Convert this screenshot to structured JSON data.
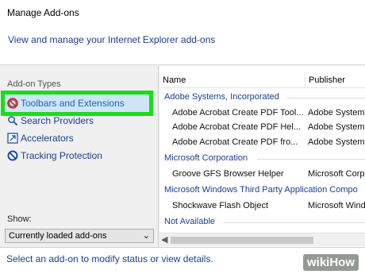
{
  "window": {
    "title": "Manage Add-ons"
  },
  "header": {
    "description": "View and manage your Internet Explorer add-ons"
  },
  "addon_types": {
    "label": "Add-on Types",
    "items": [
      {
        "label": "Toolbars and Extensions",
        "icon": "gear-no-icon",
        "selected": true
      },
      {
        "label": "Search Providers",
        "icon": "search-icon",
        "selected": false
      },
      {
        "label": "Accelerators",
        "icon": "accelerator-icon",
        "selected": false
      },
      {
        "label": "Tracking Protection",
        "icon": "block-icon",
        "selected": false
      }
    ]
  },
  "show": {
    "label": "Show:",
    "value": "Currently loaded add-ons"
  },
  "list": {
    "columns": [
      "Name",
      "Publisher"
    ],
    "rows": [
      {
        "type": "group",
        "name": "Adobe Systems, Incorporated"
      },
      {
        "type": "addon",
        "name": "Adobe Acrobat Create PDF Tool...",
        "publisher": "Adobe System"
      },
      {
        "type": "addon",
        "name": "Adobe Acrobat Create PDF Hel...",
        "publisher": "Adobe System"
      },
      {
        "type": "addon",
        "name": "Adobe Acrobat Create PDF fro...",
        "publisher": "Adobe System"
      },
      {
        "type": "group",
        "name": "Microsoft Corporation"
      },
      {
        "type": "addon",
        "name": "Groove GFS Browser Helper",
        "publisher": "Microsoft Corp"
      },
      {
        "type": "group",
        "name": "Microsoft Windows Third Party Application Compo"
      },
      {
        "type": "addon",
        "name": "Shockwave Flash Object",
        "publisher": "Microsoft Wind"
      },
      {
        "type": "group",
        "name": "Not Available"
      }
    ]
  },
  "status": {
    "text": "Select an add-on to modify status or view details."
  },
  "watermark": {
    "text": "wikiHow"
  },
  "colors": {
    "highlight": "#1bdc1a",
    "link": "#1a3f92",
    "selected_bg": "#cfe5f7"
  }
}
